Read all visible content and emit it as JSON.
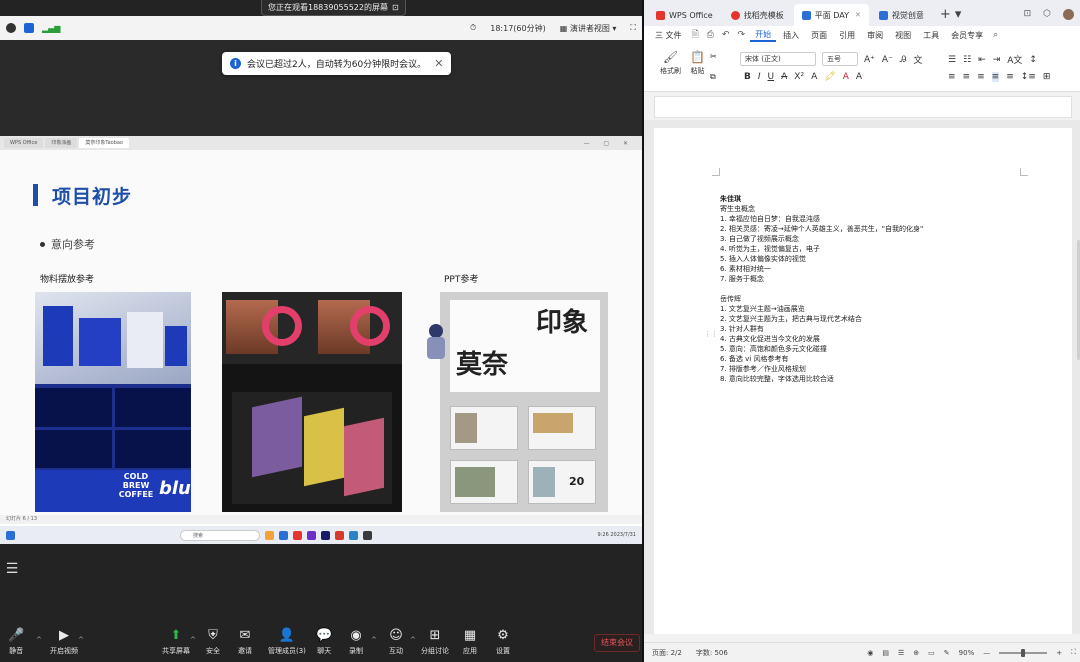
{
  "meeting": {
    "share_banner": "您正在观看18839055522的屏幕",
    "share_banner_icon": "expand-icon",
    "topbar": {
      "time": "18:17(60分钟)",
      "view_mode": "演讲者视图"
    },
    "notice": {
      "icon": "i",
      "text": "会议已超过2人，自动转为60分钟限时会议。",
      "close": "✕"
    },
    "toolbar": [
      {
        "label": "静音",
        "icon": "microphone-icon",
        "glyph": "🎤"
      },
      {
        "label": "开启视频",
        "icon": "camera-icon",
        "glyph": "▶"
      },
      {
        "label": "共享屏幕",
        "icon": "share-screen-icon",
        "glyph": "⬆"
      },
      {
        "label": "安全",
        "icon": "shield-icon",
        "glyph": "⛨"
      },
      {
        "label": "邀请",
        "icon": "invite-icon",
        "glyph": "✉"
      },
      {
        "label": "管理成员(3)",
        "icon": "members-icon",
        "glyph": "👤"
      },
      {
        "label": "聊天",
        "icon": "chat-icon",
        "glyph": "💬"
      },
      {
        "label": "录制",
        "icon": "record-icon",
        "glyph": "◉"
      },
      {
        "label": "互动",
        "icon": "interact-icon",
        "glyph": "☺"
      },
      {
        "label": "分组讨论",
        "icon": "breakout-icon",
        "glyph": "⊞"
      },
      {
        "label": "应用",
        "icon": "apps-icon",
        "glyph": "▦"
      },
      {
        "label": "设置",
        "icon": "settings-icon",
        "glyph": "⚙"
      }
    ],
    "end_button": "结束会议"
  },
  "shared_screen": {
    "tabs": [
      "WPS Office",
      "印象派画",
      "莫奈印象Taobao"
    ],
    "slide": {
      "title": "项目初步",
      "bullet": "意向参考",
      "label_material": "物料摆放参考",
      "label_ppt": "PPT参考",
      "coffee_brew": "COLD BREW COFFEE",
      "coffee_blue": "blue",
      "ppt_big1": "印象",
      "ppt_big2": "莫奈",
      "ppt_num": "20"
    },
    "status": "幻灯片 6 / 13",
    "search_placeholder": "搜索",
    "clock": "9:26 2023/7/31"
  },
  "wps": {
    "tabs": [
      {
        "label": "WPS Office",
        "color": "#e4342d",
        "active": false
      },
      {
        "label": "找稻壳模板",
        "color": "#e4342d",
        "active": false
      },
      {
        "label": "平面 DAY",
        "color": "#2b6fd6",
        "active": true
      },
      {
        "label": "视觉创意",
        "color": "#2b6fd6",
        "active": false
      }
    ],
    "menu": [
      "三 文件",
      "开始",
      "插入",
      "页面",
      "引用",
      "审阅",
      "视图",
      "工具",
      "会员专享"
    ],
    "ribbon": {
      "format_painter": "格式刷",
      "paste": "粘贴",
      "font": "宋体 (正文)",
      "size": "五号"
    },
    "doc": {
      "name1": "朱佳琪",
      "sub1": "寄生虫概念",
      "list1": [
        "1.  幸福应怕自日梦：自我混沌感",
        "2.  相关灵感：寄凌→延伸个人英雄主义，善恶共生，\"自我的化身\"",
        "3.  自己做了视频展示概念",
        "4.  听觉为主，视觉偏复古，电子",
        "5.  插入人体偏像实体的视觉",
        "6.  素材相对统一",
        "7.  服务于概念"
      ],
      "name2": "岳传辉",
      "list2": [
        "1.  文艺复兴主题→油画展览",
        "2.  文艺复兴主题为主，把古典与现代艺术结合",
        "3.  针对人群有",
        "4.  古典文化促进当今文化的发展",
        "5.  意向：高饱和颜色多元文化碰撞",
        "6.  备选 vi 风格参考有",
        "7.  排版参考／作业风格规划",
        "8.  意向比较完整，字体选用比较合适"
      ]
    },
    "status": {
      "page": "页面: 2/2",
      "words": "字数: 506",
      "zoom": "90%"
    }
  }
}
